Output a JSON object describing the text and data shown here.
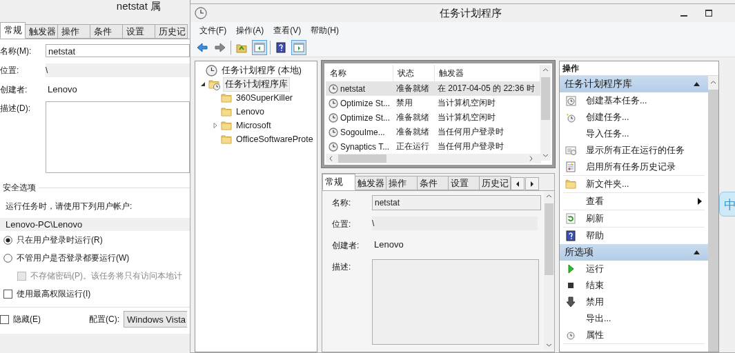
{
  "properties_dialog": {
    "title": "netstat 属",
    "tabs": [
      {
        "label": "常规",
        "selected": true
      },
      {
        "label": "触发器",
        "selected": false
      },
      {
        "label": "操作",
        "selected": false
      },
      {
        "label": "条件",
        "selected": false
      },
      {
        "label": "设置",
        "selected": false
      },
      {
        "label": "历史记",
        "selected": false
      }
    ],
    "fields": [
      {
        "label": "名称(M):",
        "value": "netstat",
        "kind": "textbox"
      },
      {
        "label": "位置:",
        "value": "\\",
        "kind": "readonly"
      },
      {
        "label": "创建者:",
        "value": "Lenovo",
        "kind": "text"
      },
      {
        "label": "描述(D):",
        "kind": "textarea"
      }
    ],
    "security": {
      "heading": "安全选项",
      "run_as_label": "运行任务时，请使用下列用户帐户:",
      "run_as_value": "Lenovo-PC\\Lenovo",
      "options": [
        {
          "kind": "radio",
          "label": "只在用户登录时运行(R)",
          "checked": true,
          "disabled": false
        },
        {
          "kind": "radio",
          "label": "不管用户是否登录都要运行(W)",
          "checked": false,
          "disabled": false,
          "children": [
            {
              "kind": "checkbox",
              "label": "不存储密码(P)。该任务将只有访问本地计",
              "checked": false,
              "disabled": true
            }
          ]
        },
        {
          "kind": "checkbox",
          "label": "使用最高权限运行(I)",
          "checked": false,
          "disabled": false
        }
      ]
    },
    "hidden": {
      "label": "隐藏(E)",
      "checked": false
    },
    "configure": {
      "label": "配置(C):",
      "value": "Windows Vista"
    }
  },
  "window": {
    "title": "任务计划程序"
  },
  "menu": [
    "文件(F)",
    "操作(A)",
    "查看(V)",
    "帮助(H)"
  ],
  "toolbar": [
    {
      "kind": "back",
      "selected": false
    },
    {
      "kind": "forward",
      "selected": false
    },
    {
      "kind": "separator"
    },
    {
      "kind": "up",
      "selected": false
    },
    {
      "kind": "tree",
      "selected": true
    },
    {
      "kind": "separator"
    },
    {
      "kind": "help",
      "selected": false
    },
    {
      "kind": "actions",
      "selected": true
    }
  ],
  "tree": {
    "label": "任务计划程序 (本地)",
    "selected": false,
    "children": [
      {
        "label": "任务计划程序库",
        "selected": true,
        "expanded": true,
        "children": [
          {
            "label": "360SuperKiller",
            "selected": false
          },
          {
            "label": "Lenovo",
            "selected": false
          },
          {
            "label": "Microsoft",
            "selected": false,
            "expanded": false
          },
          {
            "label": "OfficeSoftwareProte",
            "selected": false
          }
        ]
      }
    ]
  },
  "task_list": {
    "columns": [
      "名称",
      "状态",
      "触发器"
    ],
    "rows": [
      {
        "name": "netstat",
        "status": "准备就绪",
        "trigger": "在 2017-04-05 的 22:36 时",
        "selected": true
      },
      {
        "name": "Optimize St...",
        "status": "禁用",
        "trigger": "当计算机空闲时",
        "selected": false
      },
      {
        "name": "Optimize St...",
        "status": "准备就绪",
        "trigger": "当计算机空闲时",
        "selected": false
      },
      {
        "name": "SogouIme...",
        "status": "准备就绪",
        "trigger": "当任何用户登录时",
        "selected": false
      },
      {
        "name": "Synaptics T...",
        "status": "正在运行",
        "trigger": "当任何用户登录时",
        "selected": false
      }
    ]
  },
  "details": {
    "tabs": [
      {
        "label": "常规",
        "selected": true
      },
      {
        "label": "触发器",
        "selected": false
      },
      {
        "label": "操作",
        "selected": false
      },
      {
        "label": "条件",
        "selected": false
      },
      {
        "label": "设置",
        "selected": false
      },
      {
        "label": "历史记",
        "selected": false
      }
    ],
    "fields": [
      {
        "label": "名称:",
        "value": "netstat",
        "kind": "textbox"
      },
      {
        "label": "位置:",
        "value": "\\",
        "kind": "readonly"
      },
      {
        "label": "创建者:",
        "value": "Lenovo",
        "kind": "text"
      },
      {
        "label": "描述:",
        "kind": "textarea"
      }
    ]
  },
  "actions": {
    "heading": "操作",
    "sections": [
      {
        "title": "任务计划程序库",
        "expanded": true,
        "items": [
          {
            "label": "创建基本任务...",
            "kind": "create_basic",
            "divider": false
          },
          {
            "label": "创建任务...",
            "kind": "create",
            "divider": false
          },
          {
            "label": "导入任务...",
            "kind": "plain",
            "divider": false
          },
          {
            "label": "显示所有正在运行的任务",
            "kind": "running",
            "divider": false
          },
          {
            "label": "启用所有任务历史记录",
            "kind": "history",
            "divider": true
          },
          {
            "label": "新文件夹...",
            "kind": "folder",
            "divider": true
          },
          {
            "label": "查看",
            "kind": "submenu",
            "divider": true
          },
          {
            "label": "刷新",
            "kind": "refresh",
            "divider": true
          },
          {
            "label": "帮助",
            "kind": "help",
            "divider": false
          }
        ]
      },
      {
        "title": "所选项",
        "expanded": true,
        "items": [
          {
            "label": "运行",
            "kind": "run",
            "divider": false
          },
          {
            "label": "结束",
            "kind": "end",
            "divider": false
          },
          {
            "label": "禁用",
            "kind": "disable",
            "divider": false
          },
          {
            "label": "导出...",
            "kind": "plain",
            "divider": false
          },
          {
            "label": "属性",
            "kind": "properties",
            "divider": true
          }
        ]
      }
    ]
  },
  "ime_indicator": {
    "label": "中"
  }
}
